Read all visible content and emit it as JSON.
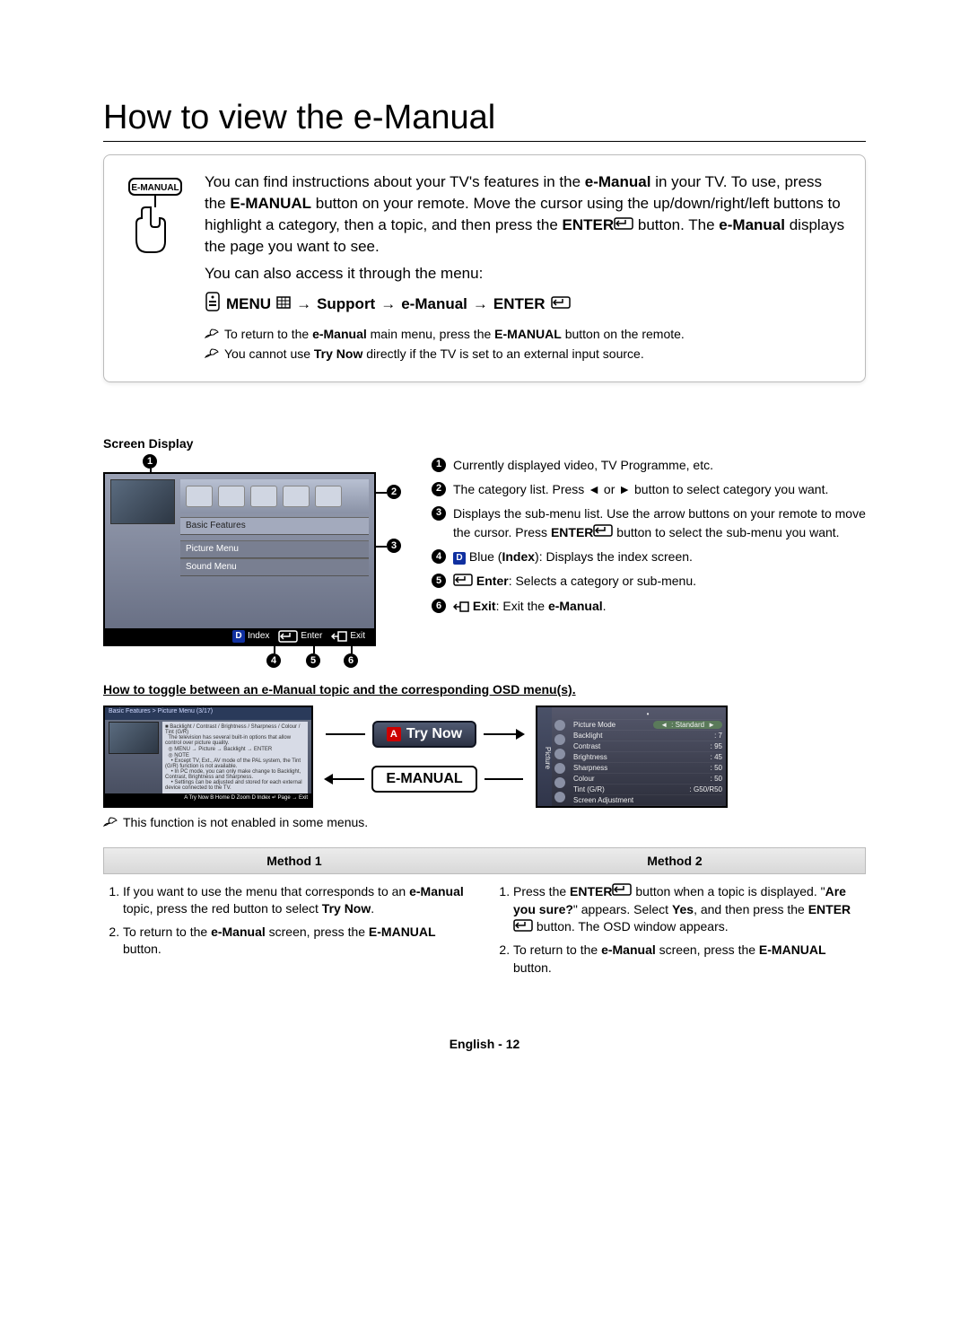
{
  "title": "How to view the e-Manual",
  "intro": {
    "p1_pre": "You can find instructions about your TV's features in the ",
    "p1_bold": "e-Manual",
    "p1_post": " in your TV. To use, press the ",
    "p1_btn": "E-MANUAL",
    "p1_mid": " button on your remote. Move the cursor using the up/down/right/left buttons to highlight a category, then a topic, and then press the ",
    "p1_enter": "ENTER",
    "p1_after_enter": " button. The ",
    "p1_bold2": "e-Manual",
    "p1_end": " displays the page you want to see.",
    "p2": "You can also access it through the menu:",
    "menu_path": {
      "menu": "MENU",
      "arrow1": "→",
      "support": "Support",
      "arrow2": "→",
      "emanual": "e-Manual",
      "arrow3": "→",
      "enter": "ENTER"
    },
    "note1_pre": "To return to the ",
    "note1_b1": "e-Manual",
    "note1_mid": " main menu, press the ",
    "note1_b2": "E-MANUAL",
    "note1_post": " button on the remote.",
    "note2_pre": "You cannot use ",
    "note2_b": "Try Now",
    "note2_post": " directly if the TV is set to an external input source."
  },
  "screen_display_label": "Screen Display",
  "tv": {
    "tab_basic": "Basic Features",
    "tab_picture": "Picture Menu",
    "tab_sound": "Sound Menu",
    "footer_index": "Index",
    "footer_enter": "Enter",
    "footer_exit": "Exit",
    "footer_d": "D"
  },
  "legend": [
    {
      "n": "1",
      "text": "Currently displayed video, TV Programme, etc."
    },
    {
      "n": "2",
      "text": "The category list. Press ◄ or ► button to select category you want."
    },
    {
      "n": "3",
      "pre": "Displays the sub-menu list. Use the arrow buttons on your remote to move the cursor. Press ",
      "mid": "ENTER",
      "post": " button to select the sub-menu you want."
    },
    {
      "n": "4",
      "pre_badge": "D",
      "pre_txt": " Blue (",
      "b": "Index",
      "post": "): Displays the index screen."
    },
    {
      "n": "5",
      "b": "Enter",
      "post": ": Selects a category or sub-menu."
    },
    {
      "n": "6",
      "b": "Exit",
      "post": ": Exit the ",
      "b2": "e-Manual",
      "post2": "."
    }
  ],
  "toggle_heading": "How to toggle between an e-Manual topic and the corresponding OSD menu(s).",
  "toggle": {
    "thumb1_title": "Basic Features > Picture Menu (3/17)",
    "thumb1_body_b": "Backlight / Contrast / Brightness / Sharpness / Colour / Tint (G/R)",
    "thumb1_foot": "A Try Now  B Home  D Zoom  D Index  ↵ Page  → Exit",
    "try_now": "Try Now",
    "emanual_btn": "E-MANUAL",
    "osd": {
      "side": "Picture",
      "rows": [
        {
          "k": "Picture Mode",
          "v": ": Standard"
        },
        {
          "k": "Backlight",
          "v": ": 7"
        },
        {
          "k": "Contrast",
          "v": ": 95"
        },
        {
          "k": "Brightness",
          "v": ": 45"
        },
        {
          "k": "Sharpness",
          "v": ": 50"
        },
        {
          "k": "Colour",
          "v": ": 50"
        },
        {
          "k": "Tint (G/R)",
          "v": ": G50/R50"
        },
        {
          "k": "Screen Adjustment",
          "v": ""
        }
      ]
    },
    "note_pre": "This function is not enabled in some menus."
  },
  "methods": {
    "h1": "Method 1",
    "h2": "Method 2",
    "m1": [
      {
        "pre": "If you want to use the menu that corresponds to an ",
        "b1": "e-Manual",
        "mid": " topic, press the red button to select ",
        "b2": "Try Now",
        "post": "."
      },
      {
        "pre": "To return to the ",
        "b1": "e-Manual",
        "mid": " screen, press the ",
        "b2": "E-MANUAL",
        "post": " button."
      }
    ],
    "m2": [
      {
        "pre": "Press the ",
        "b1": "ENTER",
        "mid": " button when a topic is displayed. \"",
        "b2": "Are you sure?",
        "mid2": "\" appears. Select ",
        "b3": "Yes",
        "mid3": ", and then press the ",
        "b4": "ENTER",
        "post": " button. The OSD window appears."
      },
      {
        "pre": "To return to the ",
        "b1": "e-Manual",
        "mid": " screen, press the ",
        "b2": "E-MANUAL",
        "post": " button."
      }
    ]
  },
  "footer": "English - 12"
}
